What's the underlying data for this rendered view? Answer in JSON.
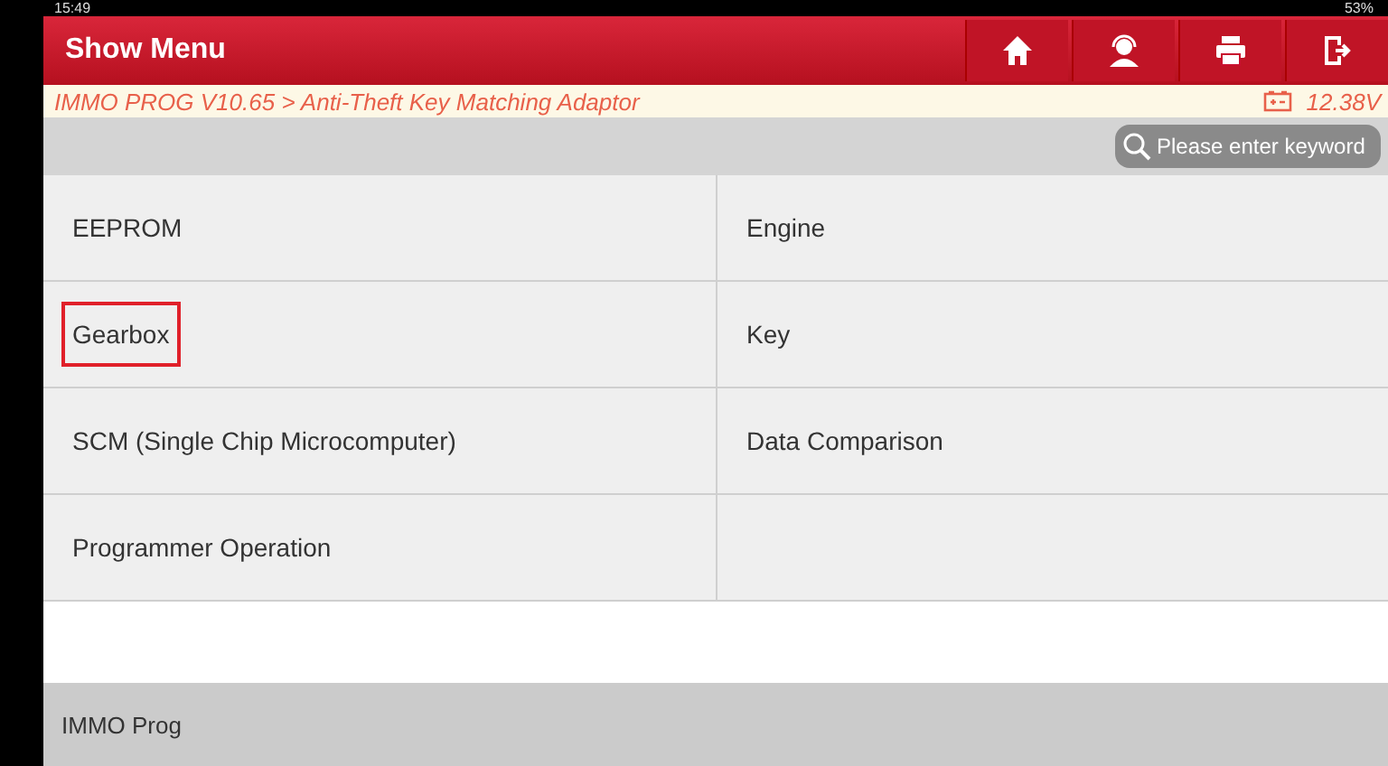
{
  "status_bar": {
    "time": "15:49",
    "battery": "53%"
  },
  "header": {
    "title": "Show Menu",
    "buttons": [
      {
        "kind": "home"
      },
      {
        "kind": "support"
      },
      {
        "kind": "print"
      },
      {
        "kind": "exit"
      }
    ]
  },
  "breadcrumb": {
    "path": "IMMO PROG V10.65 > Anti-Theft Key Matching Adaptor",
    "voltage": "12.38V"
  },
  "search": {
    "placeholder": "Please enter keyword"
  },
  "menu_items": [
    {
      "label": "EEPROM",
      "highlighted": false
    },
    {
      "label": "Engine",
      "highlighted": false
    },
    {
      "label": "Gearbox",
      "highlighted": true
    },
    {
      "label": "Key",
      "highlighted": false
    },
    {
      "label": "SCM (Single Chip Microcomputer)",
      "highlighted": false
    },
    {
      "label": "Data Comparison",
      "highlighted": false
    },
    {
      "label": "Programmer Operation",
      "highlighted": false
    }
  ],
  "footer": {
    "label": "IMMO Prog"
  }
}
